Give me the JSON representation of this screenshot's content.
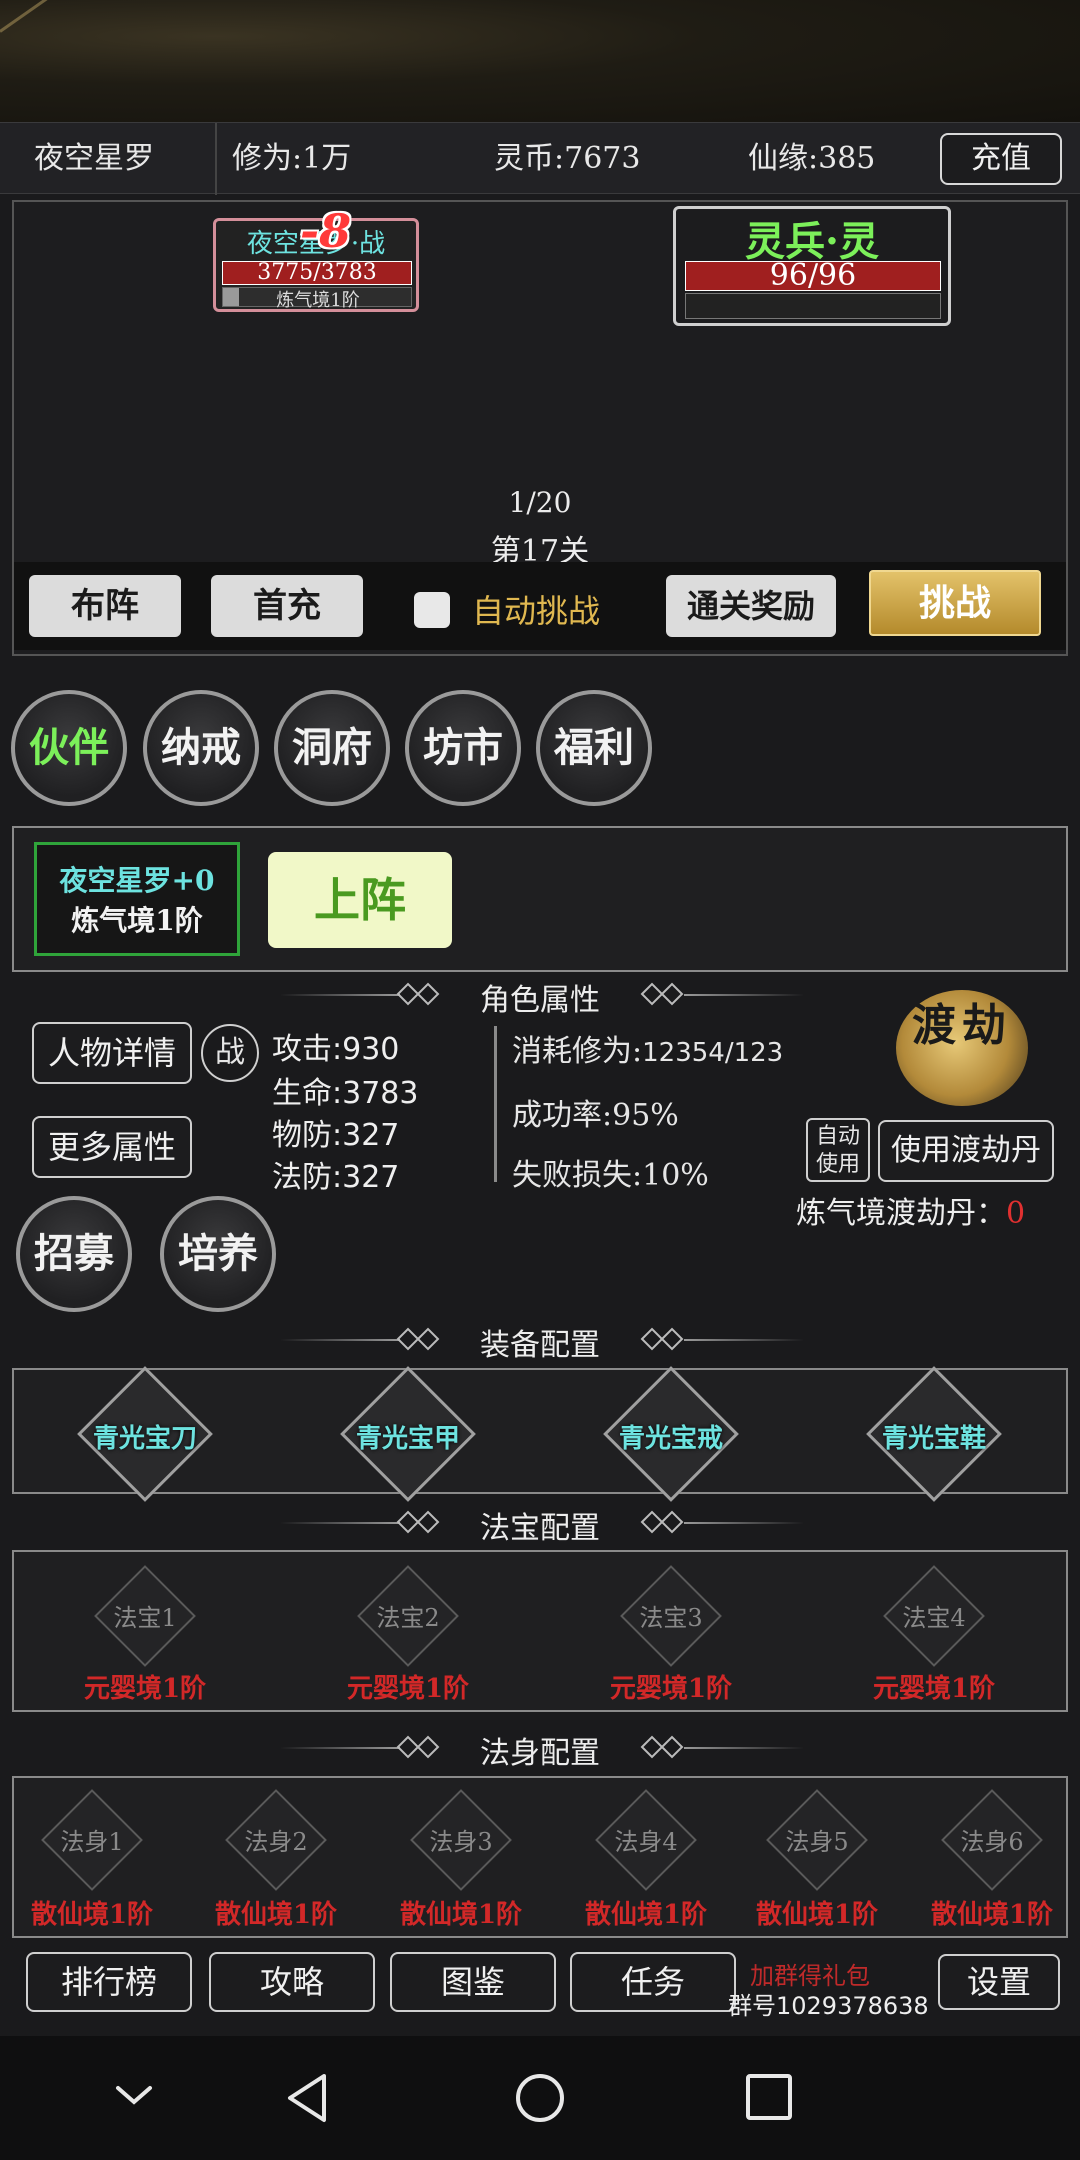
{
  "header": {
    "player_name": "夜空星罗",
    "cultivation": "修为:1万",
    "spirit_coins": "灵币:7673",
    "destiny": "仙缘:385",
    "recharge_label": "充值"
  },
  "battle": {
    "player_card": {
      "name": "夜空星罗·战",
      "hp": "3775/3783",
      "realm": "炼气境1阶",
      "damage": "-8"
    },
    "enemy_card": {
      "name": "灵兵·灵",
      "hp": "96/96"
    },
    "progress": "1/20",
    "stage": "第17关",
    "formation_label": "布阵",
    "first_recharge_label": "首充",
    "auto_challenge_label": "自动挑战",
    "clear_reward_label": "通关奖励",
    "challenge_label": "挑战"
  },
  "menu": {
    "items": [
      "伙伴",
      "纳戒",
      "洞府",
      "坊市",
      "福利"
    ]
  },
  "partner": {
    "name": "夜空星罗+0",
    "realm": "炼气境1阶",
    "deploy_label": "上阵"
  },
  "attributes": {
    "title": "角色属性",
    "details_label": "人物详情",
    "battle_badge": "战",
    "more_label": "更多属性",
    "attack": "攻击:930",
    "life": "生命:3783",
    "phys_def": "物防:327",
    "magic_def": "法防:327",
    "cost": "消耗修为:",
    "cost_value": "12354/123",
    "success": "成功率:95%",
    "failure": "失败损失:10%",
    "tribulation_logo": "渡劫",
    "auto_use": "自动使用",
    "use_pill_label": "使用渡劫丹",
    "pill_count_label": "炼气境渡劫丹：",
    "pill_count": "0",
    "recruit_label": "招募",
    "train_label": "培养"
  },
  "equipment": {
    "title": "装备配置",
    "items": [
      "青光宝刀",
      "青光宝甲",
      "青光宝戒",
      "青光宝鞋"
    ]
  },
  "treasures": {
    "title": "法宝配置",
    "slots": [
      {
        "label": "法宝1",
        "req": "元婴境1阶"
      },
      {
        "label": "法宝2",
        "req": "元婴境1阶"
      },
      {
        "label": "法宝3",
        "req": "元婴境1阶"
      },
      {
        "label": "法宝4",
        "req": "元婴境1阶"
      }
    ]
  },
  "bodies": {
    "title": "法身配置",
    "slots": [
      {
        "label": "法身1",
        "req": "散仙境1阶"
      },
      {
        "label": "法身2",
        "req": "散仙境1阶"
      },
      {
        "label": "法身3",
        "req": "散仙境1阶"
      },
      {
        "label": "法身4",
        "req": "散仙境1阶"
      },
      {
        "label": "法身5",
        "req": "散仙境1阶"
      },
      {
        "label": "法身6",
        "req": "散仙境1阶"
      }
    ]
  },
  "bottom": {
    "ranking": "排行榜",
    "guide": "攻略",
    "codex": "图鉴",
    "tasks": "任务",
    "group_gift": "加群得礼包",
    "group_number": "群号1029378638",
    "settings": "设置"
  },
  "colors": {
    "active_menu": "#7cf05a",
    "equip_name": "#6de3e0",
    "requirement": "#d22828",
    "hp_bar": "#a01f1f",
    "gold": "#d9b45a"
  },
  "icons": [
    "back-icon",
    "home-icon",
    "recents-icon",
    "nav-down-icon"
  ]
}
